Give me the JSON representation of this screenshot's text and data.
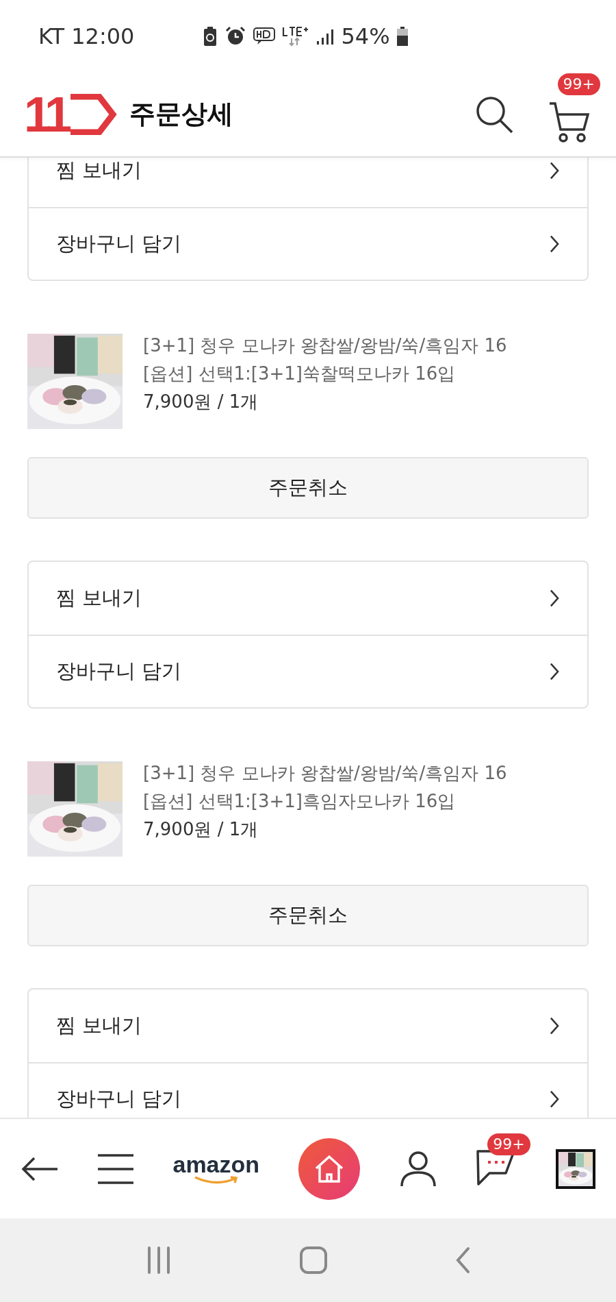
{
  "status_bar": {
    "carrier_time": "KT 12:00",
    "battery": "54%"
  },
  "header": {
    "logo": "11",
    "title": "주문상세",
    "cart_badge": "99+"
  },
  "content": [
    {
      "kind": "actions",
      "rows": [
        "찜 보내기",
        "장바구니 담기"
      ]
    },
    {
      "kind": "product",
      "title": "[3+1] 청우 모나카 왕찹쌀/왕밤/쑥/흑임자 16",
      "option": "[옵션] 선택1:[3+1]쑥찰떡모나카 16입",
      "price": "7,900원 / 1개"
    },
    {
      "kind": "button",
      "label": "주문취소"
    },
    {
      "kind": "actions",
      "rows": [
        "찜 보내기",
        "장바구니 담기"
      ]
    },
    {
      "kind": "product",
      "title": "[3+1] 청우 모나카 왕찹쌀/왕밤/쑥/흑임자 16",
      "option": "[옵션] 선택1:[3+1]흑임자모나카 16입",
      "price": "7,900원 / 1개"
    },
    {
      "kind": "button",
      "label": "주문취소"
    },
    {
      "kind": "actions",
      "rows": [
        "찜 보내기",
        "장바구니 담기"
      ]
    }
  ],
  "bottom_nav": {
    "brand": "amazon",
    "chat_badge": "99+"
  }
}
